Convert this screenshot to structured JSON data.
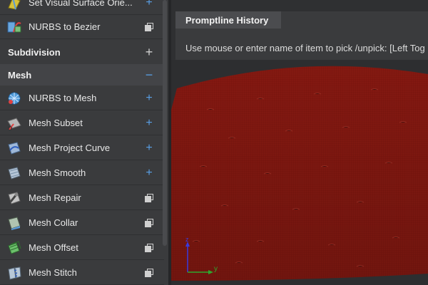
{
  "panel": {
    "tools_top": [
      {
        "label": "Set Visual Surface Orie...",
        "icon": "visual-surface-orient-icon",
        "action": "add"
      },
      {
        "label": "NURBS to Bezier",
        "icon": "nurbs-to-bezier-icon",
        "action": "copy"
      }
    ],
    "sections": {
      "subdivision": {
        "label": "Subdivision",
        "toggle": "+"
      },
      "mesh": {
        "label": "Mesh",
        "toggle": "−"
      }
    },
    "mesh_tools": [
      {
        "label": "NURBS to Mesh",
        "icon": "nurbs-to-mesh-icon",
        "action": "add"
      },
      {
        "label": "Mesh Subset",
        "icon": "mesh-subset-icon",
        "action": "add"
      },
      {
        "label": "Mesh Project Curve",
        "icon": "mesh-project-curve-icon",
        "action": "add"
      },
      {
        "label": "Mesh Smooth",
        "icon": "mesh-smooth-icon",
        "action": "add"
      },
      {
        "label": "Mesh Repair",
        "icon": "mesh-repair-icon",
        "action": "copy"
      },
      {
        "label": "Mesh Collar",
        "icon": "mesh-collar-icon",
        "action": "copy"
      },
      {
        "label": "Mesh Offset",
        "icon": "mesh-offset-icon",
        "action": "copy"
      },
      {
        "label": "Mesh Stitch",
        "icon": "mesh-stitch-icon",
        "action": "copy"
      }
    ],
    "action_glyphs": {
      "add": "+",
      "copy": "⧉"
    }
  },
  "promptline": {
    "tab_label": "Promptline History",
    "text": "Use mouse or enter name of item to pick /unpick: [Left Tog"
  },
  "viewport": {
    "axis_y_label": "y",
    "axis_z_label": "z",
    "mesh_color": "#8b1a12",
    "axis_colors": {
      "y": "#2ea82e",
      "z": "#3a3adc"
    }
  },
  "colors": {
    "accent": "#5aa0e6",
    "panel_bg": "#3a3b3d",
    "app_bg": "#2f3032"
  }
}
